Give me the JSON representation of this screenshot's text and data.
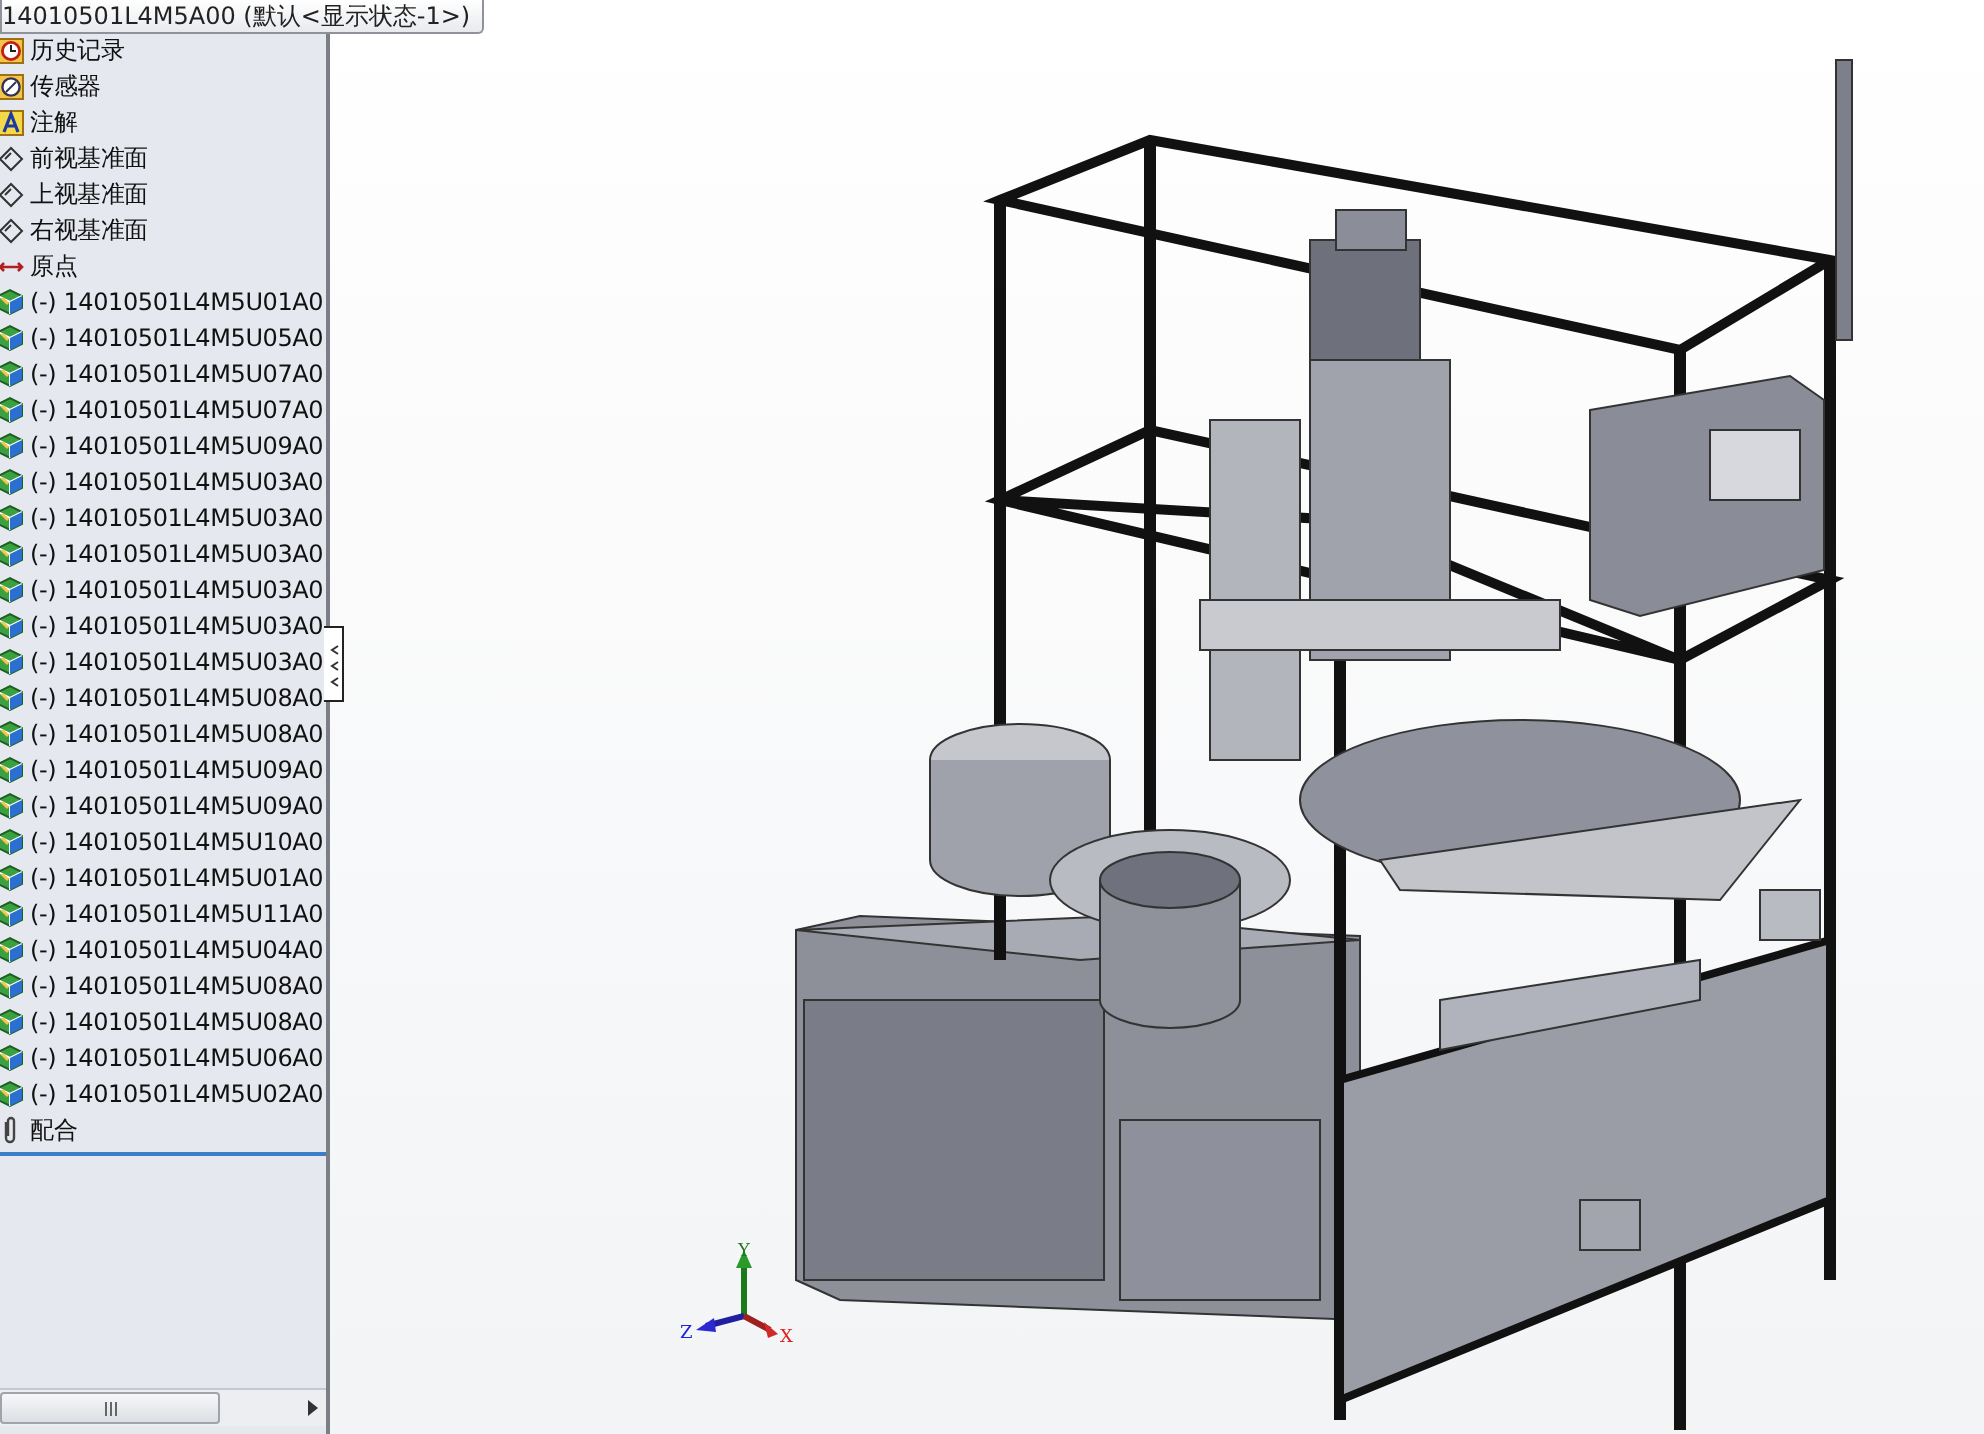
{
  "window": {
    "title": "14010501L4M5A00 (默认<显示状态-1>)"
  },
  "feature_tree": {
    "items": [
      {
        "kind": "history",
        "label": "历史记录"
      },
      {
        "kind": "sensor",
        "label": "传感器"
      },
      {
        "kind": "annotation",
        "label": "注解"
      },
      {
        "kind": "plane",
        "label": "前视基准面"
      },
      {
        "kind": "plane",
        "label": "上视基准面"
      },
      {
        "kind": "plane",
        "label": "右视基准面"
      },
      {
        "kind": "origin",
        "label": "原点"
      },
      {
        "kind": "part",
        "label": "(-) 14010501L4M5U01A0"
      },
      {
        "kind": "part",
        "label": "(-) 14010501L4M5U05A0"
      },
      {
        "kind": "part",
        "label": "(-) 14010501L4M5U07A0"
      },
      {
        "kind": "part",
        "label": "(-) 14010501L4M5U07A0"
      },
      {
        "kind": "part",
        "label": "(-) 14010501L4M5U09A0"
      },
      {
        "kind": "part",
        "label": "(-) 14010501L4M5U03A0"
      },
      {
        "kind": "part",
        "label": "(-) 14010501L4M5U03A0"
      },
      {
        "kind": "part",
        "label": "(-) 14010501L4M5U03A0"
      },
      {
        "kind": "part",
        "label": "(-) 14010501L4M5U03A0"
      },
      {
        "kind": "part",
        "label": "(-) 14010501L4M5U03A0"
      },
      {
        "kind": "part",
        "label": "(-) 14010501L4M5U03A0"
      },
      {
        "kind": "part",
        "label": "(-) 14010501L4M5U08A0"
      },
      {
        "kind": "part",
        "label": "(-) 14010501L4M5U08A0"
      },
      {
        "kind": "part",
        "label": "(-) 14010501L4M5U09A0"
      },
      {
        "kind": "part",
        "label": "(-) 14010501L4M5U09A0"
      },
      {
        "kind": "part",
        "label": "(-) 14010501L4M5U10A0"
      },
      {
        "kind": "part",
        "label": "(-) 14010501L4M5U01A0"
      },
      {
        "kind": "part",
        "label": "(-) 14010501L4M5U11A0"
      },
      {
        "kind": "part",
        "label": "(-) 14010501L4M5U04A0"
      },
      {
        "kind": "part",
        "label": "(-) 14010501L4M5U08A0"
      },
      {
        "kind": "part",
        "label": "(-) 14010501L4M5U08A0"
      },
      {
        "kind": "part",
        "label": "(-) 14010501L4M5U06A0"
      },
      {
        "kind": "part",
        "label": "(-) 14010501L4M5U02A0"
      },
      {
        "kind": "mate",
        "label": "配合"
      }
    ]
  },
  "triad": {
    "x": "X",
    "y": "Y",
    "z": "Z"
  }
}
